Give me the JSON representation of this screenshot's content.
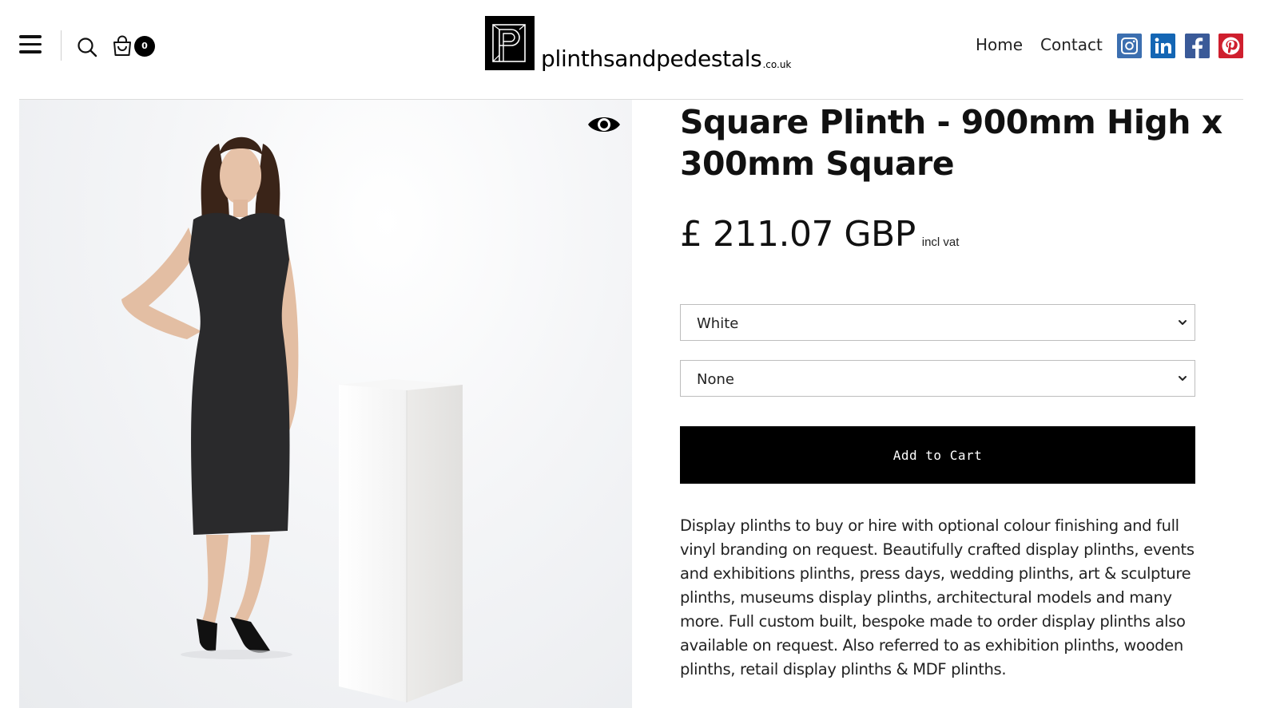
{
  "header": {
    "cart_count": "0",
    "logo_text": "plinthsandpedestals",
    "logo_suffix": ".co.uk",
    "nav": {
      "home": "Home",
      "contact": "Contact"
    },
    "social_icons": [
      "instagram-icon",
      "linkedin-icon",
      "facebook-icon",
      "pinterest-icon"
    ],
    "social_colors": {
      "instagram": "#3c6fb0",
      "linkedin": "#1466b4",
      "facebook": "#3a5a98",
      "pinterest": "#cf1f2e"
    }
  },
  "product": {
    "title": "Square Plinth - 900mm High x 300mm Square",
    "price": "£ 211.07 GBP",
    "price_note": "incl vat",
    "colour_select": {
      "value": "White"
    },
    "option_select": {
      "value": "None"
    },
    "add_to_cart_label": "Add to Cart",
    "description": "Display plinths to buy or hire with optional colour finishing and full vinyl branding on request. Beautifully crafted display plinths, events and exhibitions plinths, press days, wedding plinths, art & sculpture plinths, museums display plinths, architectural models and many more. Full custom built, bespoke made to order display plinths also available on request. Also referred to as exhibition plinths, wooden plinths, retail display plinths & MDF plinths."
  },
  "colors": {
    "button_bg": "#000000",
    "button_text": "#ffffff",
    "border": "#bdbdbd"
  }
}
